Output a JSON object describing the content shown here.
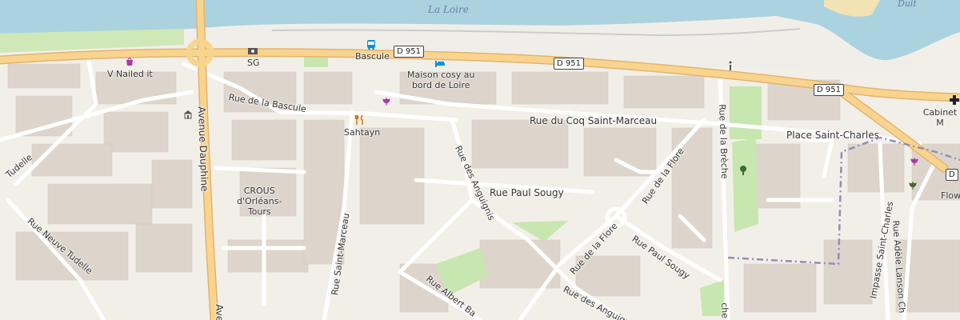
{
  "map": {
    "water_labels": {
      "loire": "La Loire",
      "duit": "Duit"
    },
    "roads": {
      "d951_a": "D 951",
      "d951_b": "D 951",
      "d951_c": "D 951",
      "d951_d": "D",
      "rue_bascule": "Rue de la Bascule",
      "coq_saint_marceau": "Rue du Coq Saint-Marceau",
      "place_saint_charles": "Place Saint-Charles",
      "tudelle": "Tudelle",
      "avenue_dauphine": "Avenue Dauphine",
      "avenue_dauphine_b": "Ave",
      "rue_neuve_tudelle": "Rue Neuve Tudelle",
      "rue_saint_marceau": "Rue Saint-Marceau",
      "rue_anguignis": "Rue des Anguignis",
      "rue_anguignis_b": "Rue des Anguignis",
      "rue_paul_sougy": "Rue Paul Sougy",
      "rue_paul_sougy_b": "Rue Paul Sougy",
      "rue_de_la_flore": "Rue de la Flore",
      "rue_de_la_flore_b": "Rue de la Flore",
      "rue_de_la_breche": "Rue de la Brèche",
      "rue_de_la_breche_b": "che",
      "impasse_saint_charles": "Impasse Saint-Charles",
      "rue_adele_lanson": "Rue Adèle Lanson Ch",
      "rue_albert": "Rue Albert Ba"
    },
    "pois": {
      "v_nailed": "V Nailed it",
      "sg": "SG",
      "bascule": "Bascule",
      "maison_cosy": "Maison cosy au\nbord de Loire",
      "sahtayn": "Sahtayn",
      "crous": "CROUS\nd'Orléans-\nTours",
      "cabinet": "Cabinet M",
      "flow": "Flow"
    },
    "icons": [
      "shopping-bag-icon",
      "atm-icon",
      "bus-stop-icon",
      "hotel-icon",
      "restaurant-icon",
      "florist-icon",
      "info-icon",
      "pharmacy-cross-icon",
      "tree-icon",
      "townhall-icon"
    ],
    "colors": {
      "background": "#f2efe9",
      "water": "#aad3df",
      "sand": "#f2e3b4",
      "primary_road": "#f8d48f",
      "park": "#c8e6b0",
      "building": "#ddd5cc",
      "boundary": "#8f8fb8"
    }
  }
}
